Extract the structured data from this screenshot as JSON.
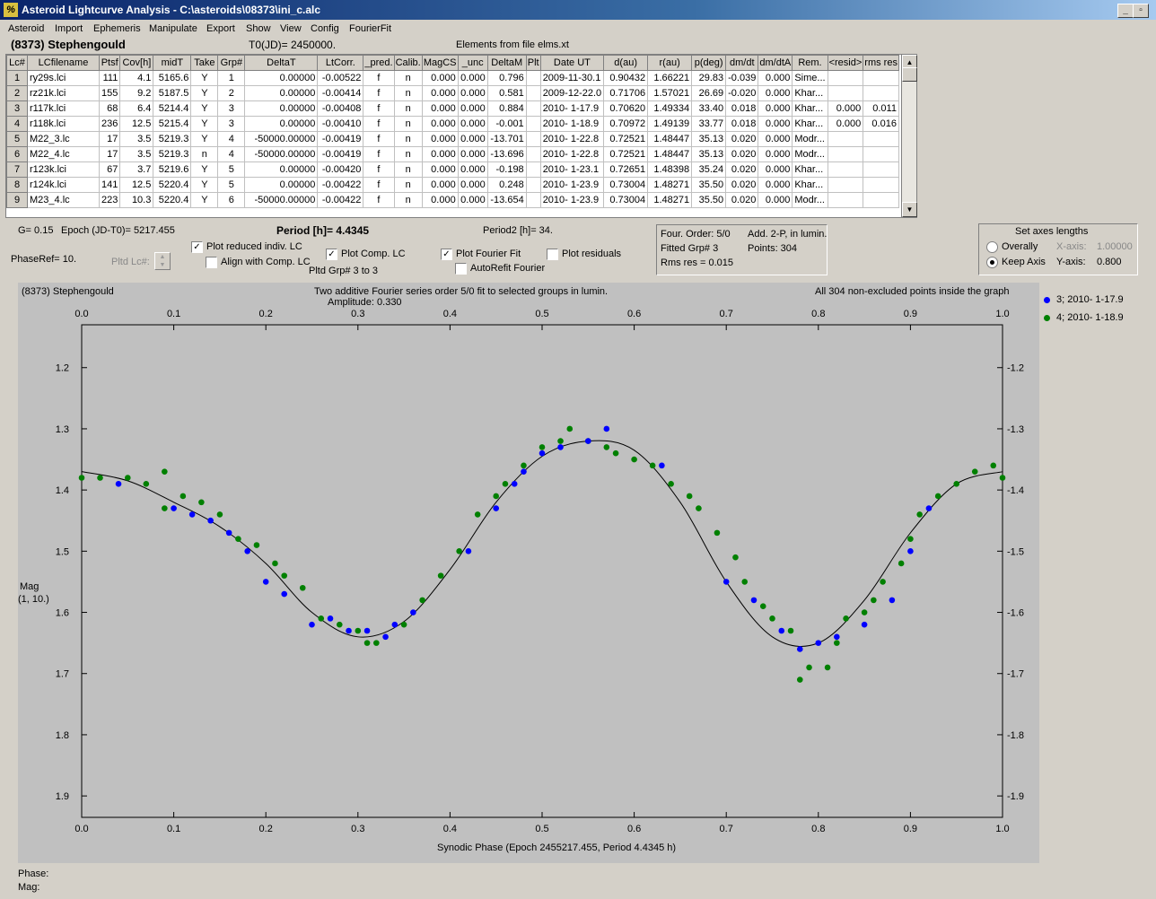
{
  "window": {
    "title": "Asteroid Lightcurve Analysis - C:\\asteroids\\08373\\ini_c.alc",
    "icon": "program-icon",
    "min": "_",
    "restore": "▫",
    "close": "X"
  },
  "menu": [
    "Asteroid",
    "Import",
    "Ephemeris",
    "Manipulate",
    "Export",
    "Show",
    "View",
    "Config",
    "FourierFit"
  ],
  "header": {
    "asteroid": "(8373) Stephengould",
    "t0": "T0(JD)= 2450000.",
    "elements": "Elements from file elms.xt"
  },
  "table": {
    "columns": [
      "Lc#",
      "LCfilename",
      "Ptsf",
      "Cov[h]",
      "midT",
      "Take",
      "Grp#",
      "DeltaT",
      "LtCorr.",
      "_pred.",
      "Calib.",
      "MagCS",
      "_unc",
      "DeltaM",
      "Plt",
      "Date UT",
      "d(au)",
      "r(au)",
      "p(deg)",
      "dm/dt",
      "dm/dtA",
      "Rem.",
      "<resid>",
      "rms res"
    ],
    "rows": [
      [
        "1",
        "ry29s.lci",
        "111",
        "4.1",
        "5165.6",
        "Y",
        "1",
        "0.00000",
        "-0.00522",
        "f",
        "n",
        "0.000",
        "0.000",
        "0.796",
        "",
        "2009-11-30.1",
        "0.90432",
        "1.66221",
        "29.83",
        "-0.039",
        "0.000",
        "Sime...",
        "",
        ""
      ],
      [
        "2",
        "rz21k.lci",
        "155",
        "9.2",
        "5187.5",
        "Y",
        "2",
        "0.00000",
        "-0.00414",
        "f",
        "n",
        "0.000",
        "0.000",
        "0.581",
        "",
        "2009-12-22.0",
        "0.71706",
        "1.57021",
        "26.69",
        "-0.020",
        "0.000",
        "Khar...",
        "",
        ""
      ],
      [
        "3",
        "r117k.lci",
        "68",
        "6.4",
        "5214.4",
        "Y",
        "3",
        "0.00000",
        "-0.00408",
        "f",
        "n",
        "0.000",
        "0.000",
        "0.884",
        "",
        "2010- 1-17.9",
        "0.70620",
        "1.49334",
        "33.40",
        "0.018",
        "0.000",
        "Khar...",
        "0.000",
        "0.011"
      ],
      [
        "4",
        "r118k.lci",
        "236",
        "12.5",
        "5215.4",
        "Y",
        "3",
        "0.00000",
        "-0.00410",
        "f",
        "n",
        "0.000",
        "0.000",
        "-0.001",
        "",
        "2010- 1-18.9",
        "0.70972",
        "1.49139",
        "33.77",
        "0.018",
        "0.000",
        "Khar...",
        "0.000",
        "0.016"
      ],
      [
        "5",
        "M22_3.lc",
        "17",
        "3.5",
        "5219.3",
        "Y",
        "4",
        "-50000.00000",
        "-0.00419",
        "f",
        "n",
        "0.000",
        "0.000",
        "-13.701",
        "",
        "2010- 1-22.8",
        "0.72521",
        "1.48447",
        "35.13",
        "0.020",
        "0.000",
        "Modr...",
        "",
        ""
      ],
      [
        "6",
        "M22_4.lc",
        "17",
        "3.5",
        "5219.3",
        "n",
        "4",
        "-50000.00000",
        "-0.00419",
        "f",
        "n",
        "0.000",
        "0.000",
        "-13.696",
        "",
        "2010- 1-22.8",
        "0.72521",
        "1.48447",
        "35.13",
        "0.020",
        "0.000",
        "Modr...",
        "",
        ""
      ],
      [
        "7",
        "r123k.lci",
        "67",
        "3.7",
        "5219.6",
        "Y",
        "5",
        "0.00000",
        "-0.00420",
        "f",
        "n",
        "0.000",
        "0.000",
        "-0.198",
        "",
        "2010- 1-23.1",
        "0.72651",
        "1.48398",
        "35.24",
        "0.020",
        "0.000",
        "Khar...",
        "",
        ""
      ],
      [
        "8",
        "r124k.lci",
        "141",
        "12.5",
        "5220.4",
        "Y",
        "5",
        "0.00000",
        "-0.00422",
        "f",
        "n",
        "0.000",
        "0.000",
        "0.248",
        "",
        "2010- 1-23.9",
        "0.73004",
        "1.48271",
        "35.50",
        "0.020",
        "0.000",
        "Khar...",
        "",
        ""
      ],
      [
        "9",
        "M23_4.lc",
        "223",
        "10.3",
        "5220.4",
        "Y",
        "6",
        "-50000.00000",
        "-0.00422",
        "f",
        "n",
        "0.000",
        "0.000",
        "-13.654",
        "",
        "2010- 1-23.9",
        "0.73004",
        "1.48271",
        "35.50",
        "0.020",
        "0.000",
        "Modr...",
        "",
        ""
      ]
    ]
  },
  "controls": {
    "g": "G= 0.15",
    "epoch": "Epoch (JD-T0)= 5217.455",
    "period": "Period [h]= 4.4345",
    "period2": "Period2 [h]= 34.",
    "phaseref": "PhaseRef= 10.",
    "pltd_lc": "Pltd Lc#:",
    "plot_reduced": "Plot reduced indiv. LC",
    "align_comp": "Align with Comp. LC",
    "plot_comp": "Plot Comp. LC",
    "pltd_grp": "Pltd Grp#  3  to  3",
    "plot_fourier": "Plot Fourier Fit",
    "autorefit": "AutoRefit Fourier",
    "plot_resid": "Plot residuals"
  },
  "fourier_box": {
    "order": "Four. Order:  5/0",
    "add": "Add. 2-P, in lumin.",
    "fitted": "Fitted Grp# 3",
    "points": "Points: 304",
    "rms": "Rms res     = 0.015"
  },
  "axes_box": {
    "title": "Set axes lengths",
    "overally": "Overally",
    "keep": "Keep Axis",
    "xaxis_label": "X-axis:",
    "xaxis_value": "1.00000",
    "yaxis_label": "Y-axis:",
    "yaxis_value": "0.800"
  },
  "plot_text": {
    "name": "(8373) Stephengould",
    "desc": "Two additive Fourier series order 5/0 fit to selected groups in lumin.",
    "amplitude": "Amplitude: 0.330",
    "points_note": "All 304 non-excluded points inside the graph",
    "ylabel1": "Mag",
    "ylabel2": "(1, 10.)"
  },
  "status": {
    "phase": "Phase:",
    "mag": "Mag:"
  },
  "colors": {
    "series3": "#0000ff",
    "series4": "#008000"
  },
  "chart_data": {
    "type": "scatter",
    "xlabel": "Synodic Phase (Epoch 2455217.455, Period 4.4345 h)",
    "ylabel": "Mag",
    "xlim": [
      0.0,
      1.0
    ],
    "ylim": [
      1.9,
      1.13
    ],
    "y_inverted": true,
    "xticks": [
      "0.0",
      "0.1",
      "0.2",
      "0.3",
      "0.4",
      "0.5",
      "0.6",
      "0.7",
      "0.8",
      "0.9",
      "1.0"
    ],
    "yticks": [
      "1.2",
      "1.3",
      "1.4",
      "1.5",
      "1.6",
      "1.7",
      "1.8",
      "1.9"
    ],
    "legend_position": "right",
    "fit_curve": {
      "x": [
        0.0,
        0.05,
        0.1,
        0.15,
        0.2,
        0.25,
        0.3,
        0.35,
        0.4,
        0.45,
        0.5,
        0.55,
        0.6,
        0.65,
        0.7,
        0.75,
        0.8,
        0.85,
        0.9,
        0.95,
        1.0
      ],
      "y": [
        1.37,
        1.385,
        1.42,
        1.46,
        1.52,
        1.6,
        1.64,
        1.615,
        1.53,
        1.42,
        1.345,
        1.32,
        1.335,
        1.42,
        1.55,
        1.64,
        1.65,
        1.58,
        1.47,
        1.39,
        1.37
      ]
    },
    "series": [
      {
        "name": "3; 2010- 1-17.9",
        "color": "#0000ff",
        "points": [
          [
            0.04,
            1.39
          ],
          [
            0.1,
            1.43
          ],
          [
            0.12,
            1.44
          ],
          [
            0.14,
            1.45
          ],
          [
            0.16,
            1.47
          ],
          [
            0.18,
            1.5
          ],
          [
            0.2,
            1.55
          ],
          [
            0.22,
            1.57
          ],
          [
            0.25,
            1.62
          ],
          [
            0.27,
            1.61
          ],
          [
            0.29,
            1.63
          ],
          [
            0.31,
            1.63
          ],
          [
            0.33,
            1.64
          ],
          [
            0.34,
            1.62
          ],
          [
            0.36,
            1.6
          ],
          [
            0.42,
            1.5
          ],
          [
            0.45,
            1.43
          ],
          [
            0.47,
            1.39
          ],
          [
            0.48,
            1.37
          ],
          [
            0.5,
            1.34
          ],
          [
            0.52,
            1.33
          ],
          [
            0.55,
            1.32
          ],
          [
            0.57,
            1.3
          ],
          [
            0.63,
            1.36
          ],
          [
            0.7,
            1.55
          ],
          [
            0.73,
            1.58
          ],
          [
            0.76,
            1.63
          ],
          [
            0.78,
            1.66
          ],
          [
            0.8,
            1.65
          ],
          [
            0.82,
            1.64
          ],
          [
            0.85,
            1.62
          ],
          [
            0.88,
            1.58
          ],
          [
            0.9,
            1.5
          ],
          [
            0.92,
            1.43
          ]
        ]
      },
      {
        "name": "4; 2010- 1-18.9",
        "color": "#008000",
        "points": [
          [
            0.0,
            1.38
          ],
          [
            0.02,
            1.38
          ],
          [
            0.05,
            1.38
          ],
          [
            0.07,
            1.39
          ],
          [
            0.09,
            1.37
          ],
          [
            0.09,
            1.43
          ],
          [
            0.11,
            1.41
          ],
          [
            0.13,
            1.42
          ],
          [
            0.15,
            1.44
          ],
          [
            0.17,
            1.48
          ],
          [
            0.19,
            1.49
          ],
          [
            0.21,
            1.52
          ],
          [
            0.22,
            1.54
          ],
          [
            0.24,
            1.56
          ],
          [
            0.26,
            1.61
          ],
          [
            0.28,
            1.62
          ],
          [
            0.3,
            1.63
          ],
          [
            0.31,
            1.65
          ],
          [
            0.32,
            1.65
          ],
          [
            0.35,
            1.62
          ],
          [
            0.37,
            1.58
          ],
          [
            0.39,
            1.54
          ],
          [
            0.41,
            1.5
          ],
          [
            0.43,
            1.44
          ],
          [
            0.45,
            1.41
          ],
          [
            0.46,
            1.39
          ],
          [
            0.48,
            1.36
          ],
          [
            0.5,
            1.33
          ],
          [
            0.52,
            1.32
          ],
          [
            0.53,
            1.3
          ],
          [
            0.55,
            1.32
          ],
          [
            0.57,
            1.33
          ],
          [
            0.58,
            1.34
          ],
          [
            0.6,
            1.35
          ],
          [
            0.62,
            1.36
          ],
          [
            0.64,
            1.39
          ],
          [
            0.66,
            1.41
          ],
          [
            0.67,
            1.43
          ],
          [
            0.69,
            1.47
          ],
          [
            0.71,
            1.51
          ],
          [
            0.72,
            1.55
          ],
          [
            0.74,
            1.59
          ],
          [
            0.75,
            1.61
          ],
          [
            0.77,
            1.63
          ],
          [
            0.78,
            1.71
          ],
          [
            0.79,
            1.69
          ],
          [
            0.81,
            1.69
          ],
          [
            0.82,
            1.65
          ],
          [
            0.83,
            1.61
          ],
          [
            0.85,
            1.6
          ],
          [
            0.86,
            1.58
          ],
          [
            0.87,
            1.55
          ],
          [
            0.89,
            1.52
          ],
          [
            0.9,
            1.48
          ],
          [
            0.91,
            1.44
          ],
          [
            0.93,
            1.41
          ],
          [
            0.95,
            1.39
          ],
          [
            0.97,
            1.37
          ],
          [
            0.99,
            1.36
          ],
          [
            1.0,
            1.38
          ]
        ]
      }
    ]
  }
}
